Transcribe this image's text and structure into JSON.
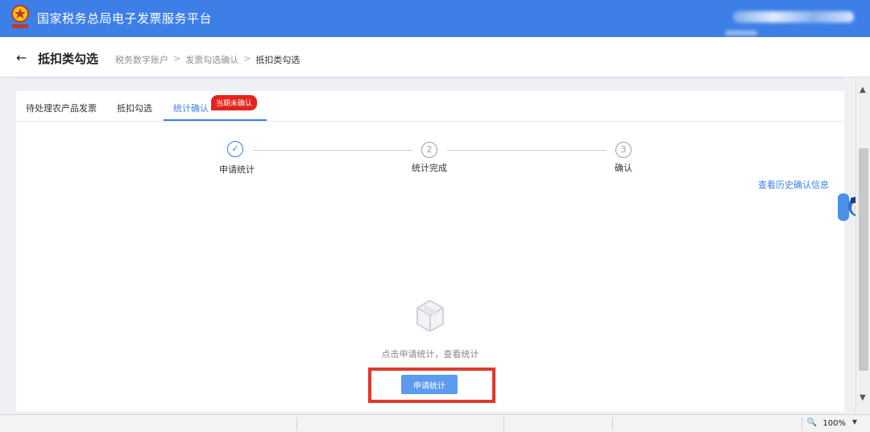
{
  "header": {
    "app_title": "国家税务总局电子发票服务平台",
    "emblem_icon": "tax-emblem-icon",
    "brand_color": "#3d7fe6"
  },
  "page": {
    "title": "抵扣类勾选",
    "back_icon": "back-arrow-icon",
    "breadcrumb": [
      "税务数字账户",
      "发票勾选确认",
      "抵扣类勾选"
    ],
    "breadcrumb_sep": ">"
  },
  "tabs": [
    {
      "label": "待处理农产品发票",
      "active": false
    },
    {
      "label": "抵扣勾选",
      "active": false
    },
    {
      "label": "统计确认",
      "active": true
    }
  ],
  "badge": "当期未确认",
  "steps": [
    {
      "marker": "✓",
      "label": "申请统计",
      "done": true
    },
    {
      "marker": "2",
      "label": "统计完成",
      "done": false
    },
    {
      "marker": "3",
      "label": "确认",
      "done": false
    }
  ],
  "history_link": "查看历史确认信息",
  "empty_state": {
    "icon": "empty-box-icon",
    "text": "点击申请统计，查看统计"
  },
  "apply_button": "申请统计",
  "highlight_color": "#e03a2e",
  "statusbar": {
    "zoom": "100%",
    "zoom_icon": "zoom-icon"
  },
  "assistant_icon": "assistant-avatar-icon"
}
